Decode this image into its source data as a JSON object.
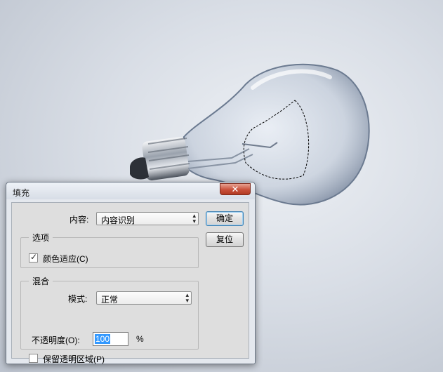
{
  "dialog": {
    "title": "填充",
    "close_icon": "close-icon",
    "contents": {
      "label": "内容:",
      "value": "内容识别"
    },
    "buttons": {
      "ok": "确定",
      "reset": "复位"
    },
    "options_group": {
      "legend": "选项",
      "color_adapt": {
        "label": "颜色适应(C)",
        "checked": true
      }
    },
    "blend_group": {
      "legend": "混合",
      "mode": {
        "label": "模式:",
        "value": "正常"
      },
      "opacity": {
        "label": "不透明度(O):",
        "value": "100",
        "unit": "%"
      },
      "preserve_transparency": {
        "label": "保留透明区域(P)",
        "checked": false
      }
    }
  },
  "colors": {
    "close_button": "#c9503a",
    "selection_highlight": "#3399ff",
    "dialog_background": "#dedede"
  }
}
